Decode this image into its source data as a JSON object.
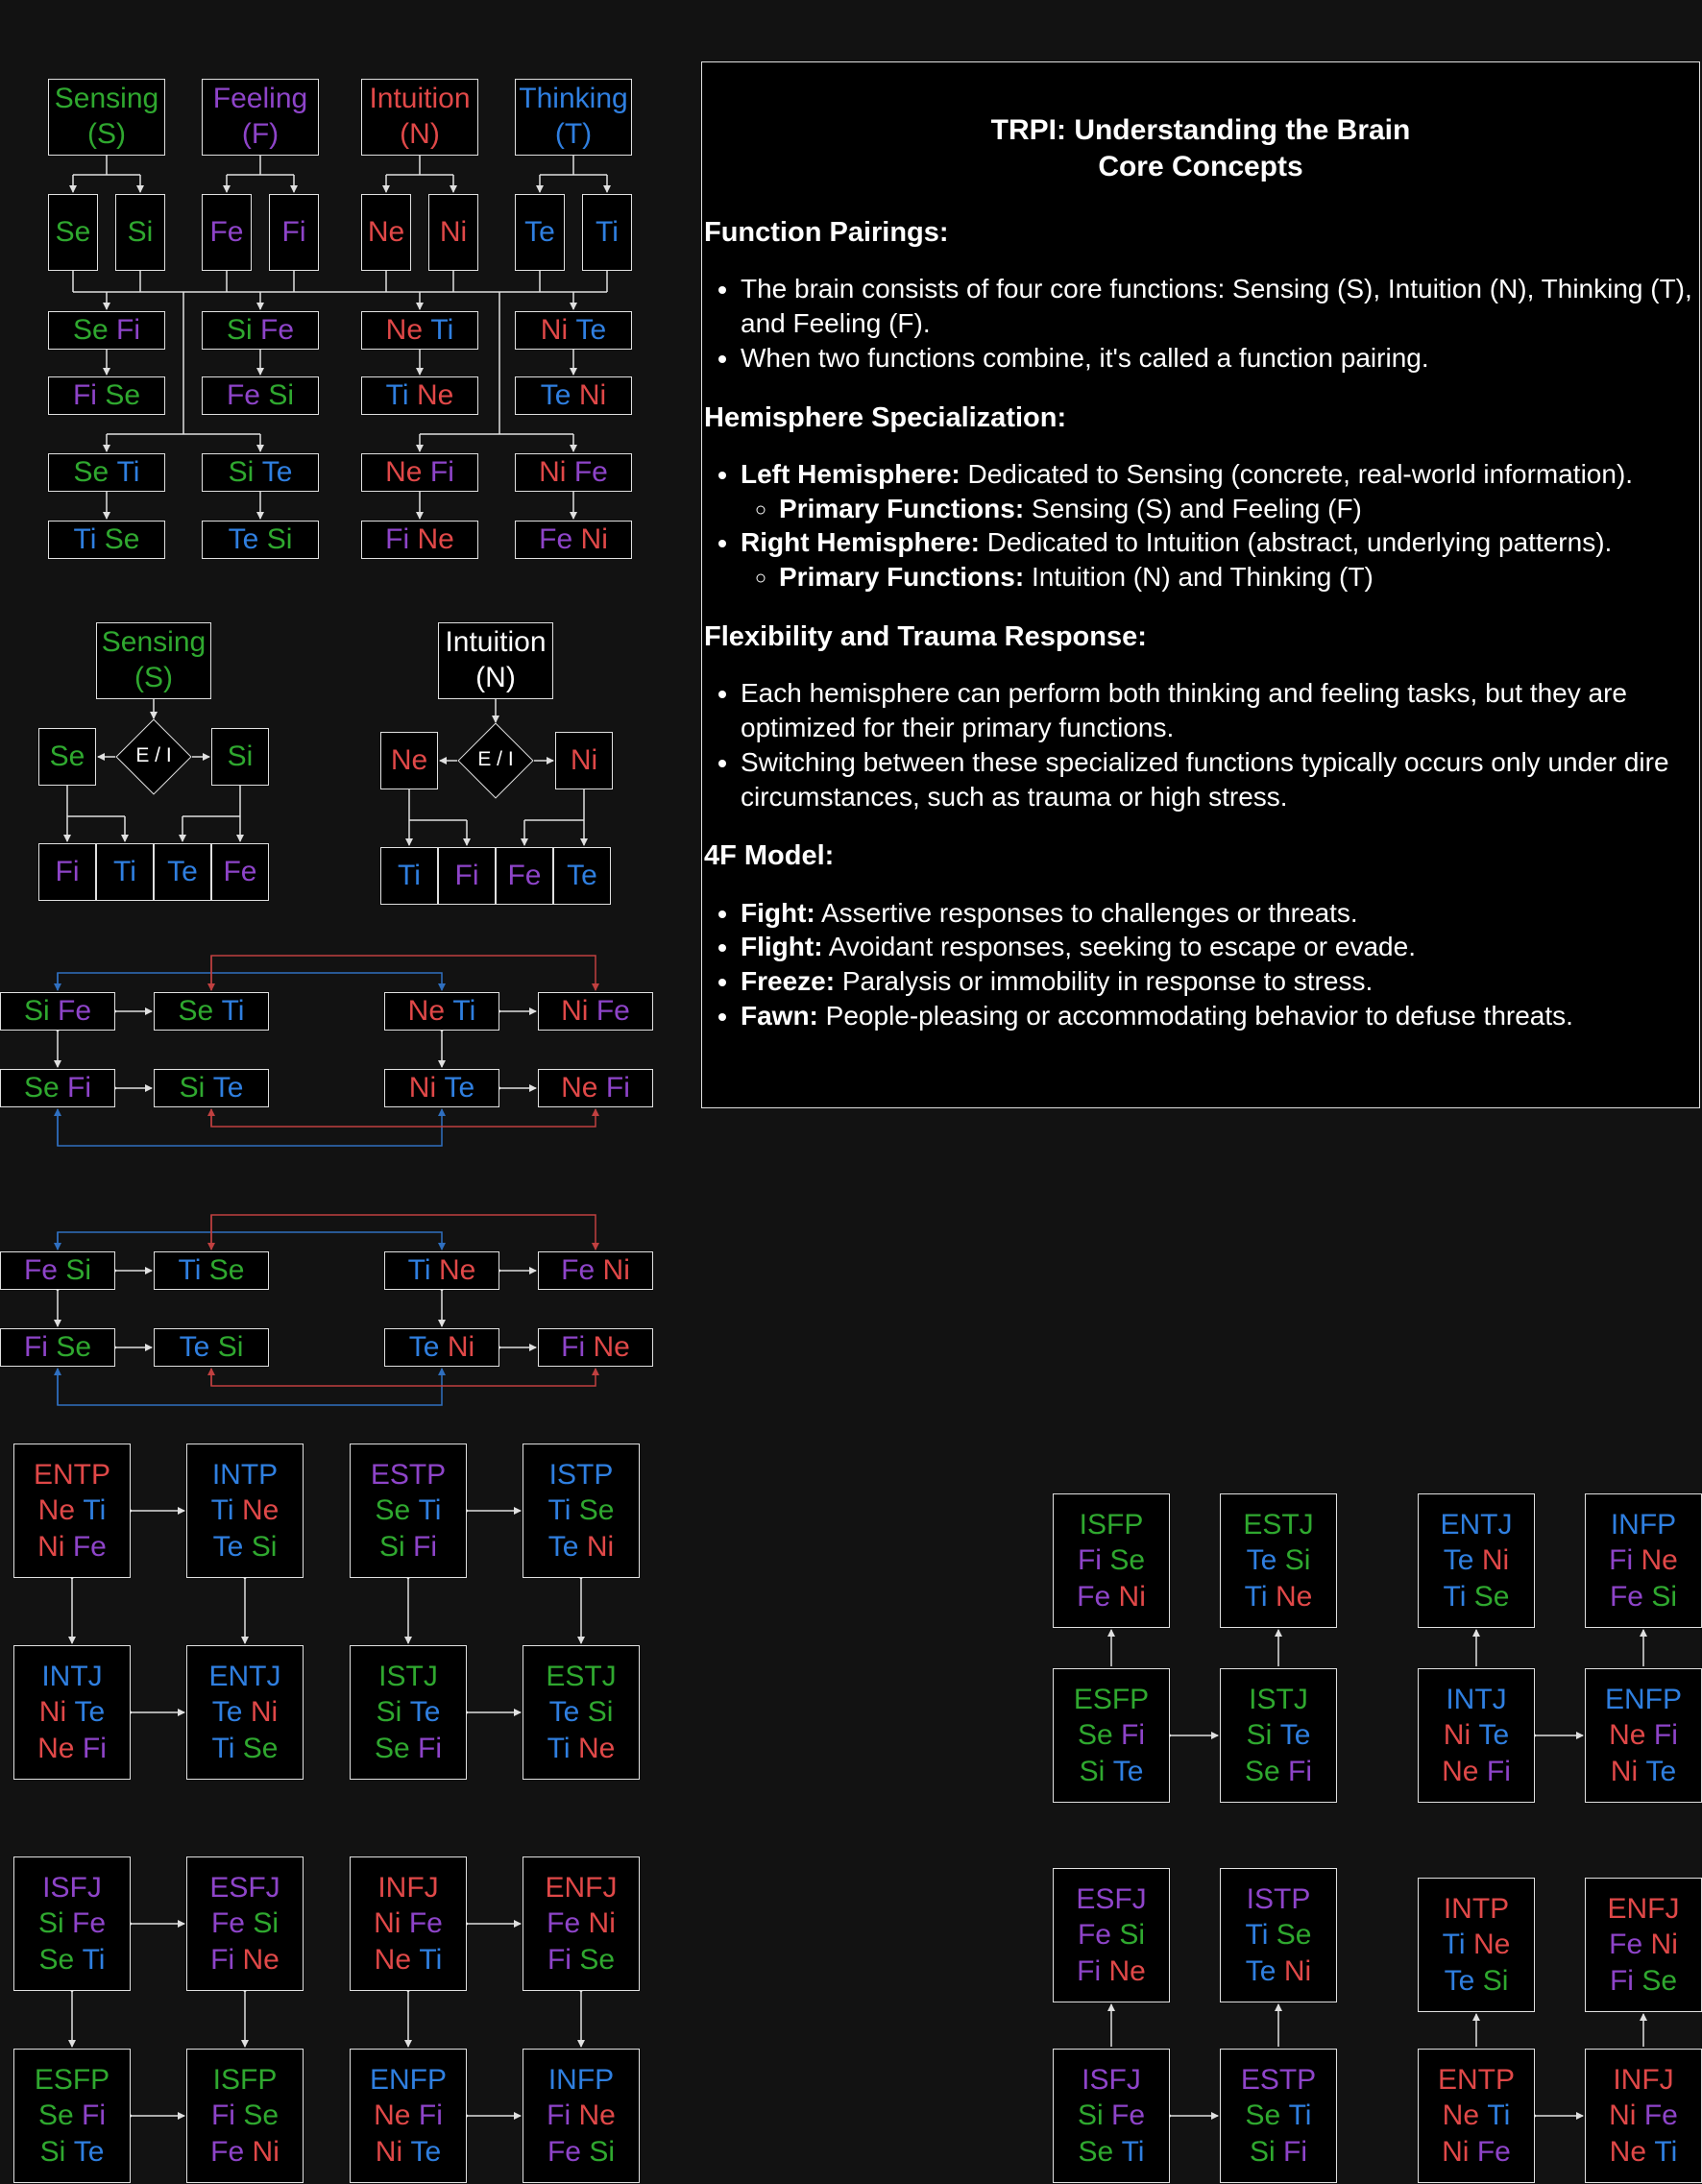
{
  "colors": {
    "S": "#2fa82f",
    "Se": "#2fa82f",
    "Si": "#2fa82f",
    "F": "#8e44c9",
    "Fe": "#8e44c9",
    "Fi": "#8e44c9",
    "N": "#e04848",
    "Ne": "#e04848",
    "Ni": "#e04848",
    "T": "#2f7fe0",
    "Te": "#2f7fe0",
    "Ti": "#2f7fe0",
    "background": "#121212",
    "box_fill": "#000000",
    "line": "#e0e0e0",
    "loop_blue": "#2f6fc0",
    "loop_red": "#c04040"
  },
  "headers": {
    "sensing": {
      "name": "Sensing",
      "code": "(S)"
    },
    "feeling": {
      "name": "Feeling",
      "code": "(F)"
    },
    "intuition": {
      "name": "Intuition",
      "code": "(N)"
    },
    "thinking": {
      "name": "Thinking",
      "code": "(T)"
    }
  },
  "singles": [
    "Se",
    "Si",
    "Fe",
    "Fi",
    "Ne",
    "Ni",
    "Te",
    "Ti"
  ],
  "pairings_row1": [
    [
      "Se",
      "Fi"
    ],
    [
      "Si",
      "Fe"
    ],
    [
      "Ne",
      "Ti"
    ],
    [
      "Ni",
      "Te"
    ]
  ],
  "pairings_row2": [
    [
      "Fi",
      "Se"
    ],
    [
      "Fe",
      "Si"
    ],
    [
      "Ti",
      "Ne"
    ],
    [
      "Te",
      "Ni"
    ]
  ],
  "pairings_row3": [
    [
      "Se",
      "Ti"
    ],
    [
      "Si",
      "Te"
    ],
    [
      "Ne",
      "Fi"
    ],
    [
      "Ni",
      "Fe"
    ]
  ],
  "pairings_row4": [
    [
      "Ti",
      "Se"
    ],
    [
      "Te",
      "Si"
    ],
    [
      "Fi",
      "Ne"
    ],
    [
      "Fe",
      "Ni"
    ]
  ],
  "ei_diagrams": [
    {
      "name": "Sensing",
      "code": "(S)",
      "left": "Se",
      "right": "Si",
      "decision": "E / I",
      "bottom": [
        "Fi",
        "Ti",
        "Te",
        "Fe"
      ]
    },
    {
      "name": "Intuition",
      "code": "(N)",
      "left": "Ne",
      "right": "Ni",
      "decision": "E / I",
      "bottom": [
        "Ti",
        "Fi",
        "Fe",
        "Te"
      ]
    }
  ],
  "loops": [
    {
      "top": [
        [
          "Si",
          "Fe"
        ],
        [
          "Se",
          "Ti"
        ],
        [
          "Ne",
          "Ti"
        ],
        [
          "Ni",
          "Fe"
        ]
      ],
      "bottom": [
        [
          "Se",
          "Fi"
        ],
        [
          "Si",
          "Te"
        ],
        [
          "Ni",
          "Te"
        ],
        [
          "Ne",
          "Fi"
        ]
      ]
    },
    {
      "top": [
        [
          "Fe",
          "Si"
        ],
        [
          "Ti",
          "Se"
        ],
        [
          "Ti",
          "Ne"
        ],
        [
          "Fe",
          "Ni"
        ]
      ],
      "bottom": [
        [
          "Fi",
          "Se"
        ],
        [
          "Te",
          "Si"
        ],
        [
          "Te",
          "Ni"
        ],
        [
          "Fi",
          "Ne"
        ]
      ]
    }
  ],
  "type_groups": [
    {
      "top": [
        {
          "t": "ENTP",
          "c": "N",
          "f": [
            [
              "Ne",
              "Ti"
            ],
            [
              "Ni",
              "Fe"
            ]
          ]
        },
        {
          "t": "INTP",
          "c": "T",
          "f": [
            [
              "Ti",
              "Ne"
            ],
            [
              "Te",
              "Si"
            ]
          ]
        },
        {
          "t": "ESTP",
          "c": "F",
          "f": [
            [
              "Se",
              "Ti"
            ],
            [
              "Si",
              "Fi"
            ]
          ]
        },
        {
          "t": "ISTP",
          "c": "T",
          "f": [
            [
              "Ti",
              "Se"
            ],
            [
              "Te",
              "Ni"
            ]
          ]
        }
      ],
      "bottom": [
        {
          "t": "INTJ",
          "c": "T",
          "f": [
            [
              "Ni",
              "Te"
            ],
            [
              "Ne",
              "Fi"
            ]
          ]
        },
        {
          "t": "ENTJ",
          "c": "T",
          "f": [
            [
              "Te",
              "Ni"
            ],
            [
              "Ti",
              "Se"
            ]
          ]
        },
        {
          "t": "ISTJ",
          "c": "S",
          "f": [
            [
              "Si",
              "Te"
            ],
            [
              "Se",
              "Fi"
            ]
          ]
        },
        {
          "t": "ESTJ",
          "c": "S",
          "f": [
            [
              "Te",
              "Si"
            ],
            [
              "Ti",
              "Ne"
            ]
          ]
        }
      ]
    },
    {
      "top": [
        {
          "t": "ISFJ",
          "c": "F",
          "f": [
            [
              "Si",
              "Fe"
            ],
            [
              "Se",
              "Ti"
            ]
          ]
        },
        {
          "t": "ESFJ",
          "c": "F",
          "f": [
            [
              "Fe",
              "Si"
            ],
            [
              "Fi",
              "Ne"
            ]
          ]
        },
        {
          "t": "INFJ",
          "c": "N",
          "f": [
            [
              "Ni",
              "Fe"
            ],
            [
              "Ne",
              "Ti"
            ]
          ]
        },
        {
          "t": "ENFJ",
          "c": "N",
          "f": [
            [
              "Fe",
              "Ni"
            ],
            [
              "Fi",
              "Se"
            ]
          ]
        }
      ],
      "bottom": [
        {
          "t": "ESFP",
          "c": "S",
          "f": [
            [
              "Se",
              "Fi"
            ],
            [
              "Si",
              "Te"
            ]
          ]
        },
        {
          "t": "ISFP",
          "c": "S",
          "f": [
            [
              "Fi",
              "Se"
            ],
            [
              "Fe",
              "Ni"
            ]
          ]
        },
        {
          "t": "ENFP",
          "c": "T",
          "f": [
            [
              "Ne",
              "Fi"
            ],
            [
              "Ni",
              "Te"
            ]
          ]
        },
        {
          "t": "INFP",
          "c": "T",
          "f": [
            [
              "Fi",
              "Ne"
            ],
            [
              "Fe",
              "Si"
            ]
          ]
        }
      ]
    },
    {
      "top": [
        {
          "t": "ISFP",
          "c": "S",
          "f": [
            [
              "Fi",
              "Se"
            ],
            [
              "Fe",
              "Ni"
            ]
          ]
        },
        {
          "t": "ESTJ",
          "c": "S",
          "f": [
            [
              "Te",
              "Si"
            ],
            [
              "Ti",
              "Ne"
            ]
          ]
        },
        {
          "t": "ENTJ",
          "c": "T",
          "f": [
            [
              "Te",
              "Ni"
            ],
            [
              "Ti",
              "Se"
            ]
          ]
        },
        {
          "t": "INFP",
          "c": "T",
          "f": [
            [
              "Fi",
              "Ne"
            ],
            [
              "Fe",
              "Si"
            ]
          ]
        }
      ],
      "bottom": [
        {
          "t": "ESFP",
          "c": "S",
          "f": [
            [
              "Se",
              "Fi"
            ],
            [
              "Si",
              "Te"
            ]
          ]
        },
        {
          "t": "ISTJ",
          "c": "S",
          "f": [
            [
              "Si",
              "Te"
            ],
            [
              "Se",
              "Fi"
            ]
          ]
        },
        {
          "t": "INTJ",
          "c": "T",
          "f": [
            [
              "Ni",
              "Te"
            ],
            [
              "Ne",
              "Fi"
            ]
          ]
        },
        {
          "t": "ENFP",
          "c": "T",
          "f": [
            [
              "Ne",
              "Fi"
            ],
            [
              "Ni",
              "Te"
            ]
          ]
        }
      ]
    },
    {
      "top": [
        {
          "t": "ESFJ",
          "c": "F",
          "f": [
            [
              "Fe",
              "Si"
            ],
            [
              "Fi",
              "Ne"
            ]
          ]
        },
        {
          "t": "ISTP",
          "c": "F",
          "f": [
            [
              "Ti",
              "Se"
            ],
            [
              "Te",
              "Ni"
            ]
          ]
        },
        {
          "t": "INTP",
          "c": "N",
          "f": [
            [
              "Ti",
              "Ne"
            ],
            [
              "Te",
              "Si"
            ]
          ]
        },
        {
          "t": "ENFJ",
          "c": "N",
          "f": [
            [
              "Fe",
              "Ni"
            ],
            [
              "Fi",
              "Se"
            ]
          ]
        }
      ],
      "bottom": [
        {
          "t": "ISFJ",
          "c": "F",
          "f": [
            [
              "Si",
              "Fe"
            ],
            [
              "Se",
              "Ti"
            ]
          ]
        },
        {
          "t": "ESTP",
          "c": "F",
          "f": [
            [
              "Se",
              "Ti"
            ],
            [
              "Si",
              "Fi"
            ]
          ]
        },
        {
          "t": "ENTP",
          "c": "N",
          "f": [
            [
              "Ne",
              "Ti"
            ],
            [
              "Ni",
              "Fe"
            ]
          ]
        },
        {
          "t": "INFJ",
          "c": "N",
          "f": [
            [
              "Ni",
              "Fe"
            ],
            [
              "Ne",
              "Ti"
            ]
          ]
        }
      ]
    }
  ],
  "panel": {
    "title_line1": "TRPI: Understanding the Brain",
    "title_line2": "Core Concepts",
    "sections": [
      {
        "heading": "Function Pairings:",
        "items": [
          {
            "bold": "",
            "text": "The brain consists of four core functions: Sensing (S), Intuition (N), Thinking (T), and Feeling (F)."
          },
          {
            "bold": "",
            "text": "When two functions combine, it's called a function pairing."
          }
        ]
      },
      {
        "heading": "Hemisphere Specialization:",
        "items": [
          {
            "bold": "Left Hemisphere:",
            "text": " Dedicated to Sensing (concrete, real-world information).",
            "sub": {
              "bold": "Primary Functions:",
              "text": " Sensing (S) and Feeling (F)"
            }
          },
          {
            "bold": "Right Hemisphere:",
            "text": " Dedicated to Intuition (abstract, underlying patterns).",
            "sub": {
              "bold": "Primary Functions:",
              "text": " Intuition (N) and Thinking (T)"
            }
          }
        ]
      },
      {
        "heading": "Flexibility and Trauma Response:",
        "items": [
          {
            "bold": "",
            "text": "Each hemisphere can perform both thinking and feeling tasks, but they are optimized for their primary functions."
          },
          {
            "bold": "",
            "text": "Switching between these specialized functions typically occurs only under dire circumstances, such as trauma or high stress."
          }
        ]
      },
      {
        "heading": "4F Model:",
        "items": [
          {
            "bold": "Fight:",
            "text": " Assertive responses to challenges or threats."
          },
          {
            "bold": "Flight:",
            "text": " Avoidant responses, seeking to escape or evade."
          },
          {
            "bold": "Freeze:",
            "text": " Paralysis or immobility in response to stress."
          },
          {
            "bold": "Fawn:",
            "text": " People-pleasing or accommodating behavior to defuse threats."
          }
        ]
      }
    ]
  }
}
